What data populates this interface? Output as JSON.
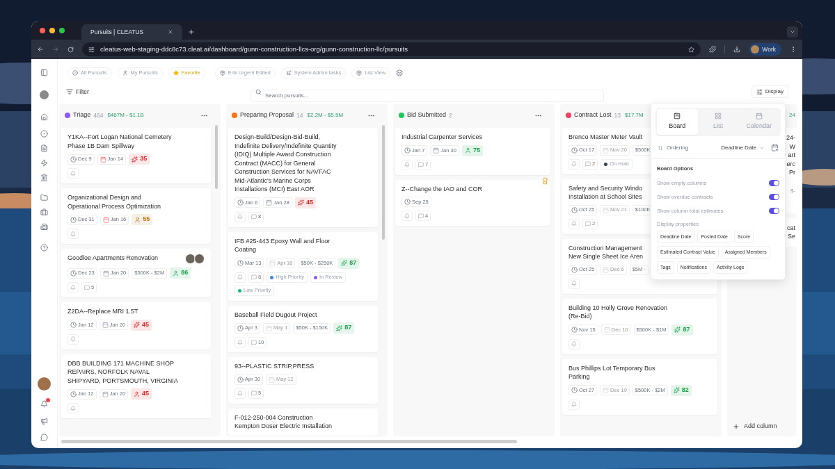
{
  "browser": {
    "tab_title": "Pursuits | CLEATUS",
    "url": "cleatus-web-staging-ddc8c73.cleat.ai/dashboard/gunn-construction-llcs-org/gunn-construction-llc/pursuits",
    "profile": "Work"
  },
  "rail": {
    "unread_notifications": true
  },
  "views": [
    {
      "label": "All Pursuits",
      "kind": "check",
      "selected": false
    },
    {
      "label": "My Pursuits",
      "kind": "person",
      "selected": false
    },
    {
      "label": "Favorite",
      "kind": "star",
      "selected": true
    },
    {
      "label": "Erik Urgent Edited",
      "kind": "stack",
      "selected": false
    },
    {
      "label": "System Admin tasks",
      "kind": "plane",
      "selected": false
    },
    {
      "label": "List View",
      "kind": "stack",
      "selected": false
    }
  ],
  "filter": {
    "label": "Filter"
  },
  "search": {
    "placeholder": "Search pursuits..."
  },
  "display_button": {
    "label": "Display"
  },
  "columns": [
    {
      "name": "Triage",
      "color": "#8b5cf6",
      "count": "464",
      "menu": true,
      "total": "$467M - $1.1B",
      "cards": [
        {
          "title": [
            "Y1KA--Fort Logan National Cemetery",
            "Phase 1B Dam Spillway"
          ],
          "chips": [
            {
              "kind": "deadline",
              "text": "Dec 9"
            },
            {
              "kind": "posted",
              "overdue": true,
              "faded": false,
              "text": "Jan 14"
            },
            {
              "kind": "score",
              "color": "#dc2626",
              "text": "35"
            }
          ],
          "bell": true
        },
        {
          "title": [
            "Organizational Design and",
            "Operational Process Optimization"
          ],
          "chips": [
            {
              "kind": "deadline",
              "text": "Dec 31"
            },
            {
              "kind": "posted",
              "overdue": true,
              "faded": false,
              "text": "Jan 16"
            },
            {
              "kind": "match",
              "color": "#b7791f",
              "text": "55"
            }
          ],
          "bell": true
        },
        {
          "title": [
            "Goodloe Apartments Renovation"
          ],
          "assignees": [
            {
              "kind": "picture"
            },
            {
              "kind": "picture"
            }
          ],
          "chips": [
            {
              "kind": "deadline",
              "text": "Dec 23"
            },
            {
              "kind": "posted",
              "overdue": false,
              "faded": false,
              "text": "Jan 20"
            },
            {
              "kind": "value",
              "text": "$500K - $2M"
            },
            {
              "kind": "match",
              "color": "#16a34a",
              "text": "86"
            }
          ],
          "bell": true,
          "comments": "5"
        },
        {
          "title": [
            "Z2DA--Replace MRI 1.5T"
          ],
          "chips": [
            {
              "kind": "deadline",
              "text": "Jan 12"
            },
            {
              "kind": "posted",
              "overdue": false,
              "faded": false,
              "text": "Jan 20"
            },
            {
              "kind": "score",
              "color": "#dc2626",
              "text": "45"
            }
          ],
          "bell": true
        },
        {
          "title": [
            "DBB BUILDING 171 MACHINE SHOP",
            "REPAIRS, NORFOLK NAVAL",
            "SHIPYARD, PORTSMOUTH, VIRGINIA"
          ],
          "chips": [
            {
              "kind": "deadline",
              "text": "Jan 12"
            },
            {
              "kind": "posted",
              "overdue": false,
              "faded": false,
              "text": "Jan 20"
            },
            {
              "kind": "match",
              "color": "#dc2626",
              "text": "45"
            }
          ],
          "bell": true
        }
      ]
    },
    {
      "name": "Preparing Proposal",
      "color": "#f97316",
      "count": "14",
      "menu": true,
      "total": "$2.2M - $5.5M",
      "cards": [
        {
          "title": [
            "Design-Build/Design-Bid-Build,",
            "Indefinite Delivery/Indefinite Quantity",
            "(IDIQ) Multiple Award Construction",
            "Contract (MACC) for General",
            "Construction Services for NAVFAC",
            "Mid-Atlantic's Marine Corps",
            "Installations (MCI) East AOR"
          ],
          "chips": [
            {
              "kind": "deadline",
              "text": "Jan 6"
            },
            {
              "kind": "posted",
              "overdue": false,
              "faded": false,
              "text": "Jan 28"
            },
            {
              "kind": "score",
              "color": "#dc2626",
              "text": "45"
            }
          ],
          "bell": true,
          "comments": "8"
        },
        {
          "title": [
            "IFB #25-443 Epoxy Wall and Floor",
            "Coating"
          ],
          "chips": [
            {
              "kind": "deadline",
              "text": "Mar 13"
            },
            {
              "kind": "posted",
              "overdue": false,
              "faded": true,
              "text": "Apr 16"
            },
            {
              "kind": "value",
              "text": "$50K - $250K"
            },
            {
              "kind": "score",
              "color": "#16a34a",
              "text": "87"
            }
          ],
          "bell": true,
          "comments": "8",
          "tags": [
            {
              "text": "High Priority",
              "color": "#3b82f6"
            },
            {
              "text": "In Review",
              "color": "#8b5cf6"
            },
            {
              "text": "Low Priority",
              "color": "#10b981"
            }
          ]
        },
        {
          "title": [
            "Baseball Field Dugout Project"
          ],
          "chips": [
            {
              "kind": "deadline",
              "text": "Apr 3"
            },
            {
              "kind": "posted",
              "overdue": false,
              "faded": true,
              "text": "May 1"
            },
            {
              "kind": "value",
              "text": "$50K - $150K"
            },
            {
              "kind": "score",
              "color": "#16a34a",
              "text": "87"
            }
          ],
          "bell": true,
          "comments": "10"
        },
        {
          "title": [
            "93--PLASTIC STRIP,PRESS"
          ],
          "chips": [
            {
              "kind": "deadline",
              "text": "Apr 30"
            },
            {
              "kind": "posted",
              "overdue": false,
              "faded": true,
              "text": "May 12"
            }
          ],
          "bell": true,
          "comments": "5"
        },
        {
          "title": [
            "F-012-250-004 Construction",
            "Kempton Doser Electric Installation"
          ],
          "bell": false
        }
      ]
    },
    {
      "name": "Bid Submitted",
      "color": "#22c55e",
      "count": "2",
      "menu": true,
      "cards": [
        {
          "title": [
            "Industrial Carpenter Services"
          ],
          "chips": [
            {
              "kind": "deadline",
              "text": "Jan 7"
            },
            {
              "kind": "posted",
              "overdue": false,
              "faded": false,
              "text": "Jan 30"
            },
            {
              "kind": "match",
              "color": "#16a34a",
              "text": "75"
            }
          ],
          "bell": true,
          "comments": "7"
        },
        {
          "title": [
            "Z--Change the IAO and COR"
          ],
          "award": true,
          "chips": [
            {
              "kind": "deadline",
              "text": "Sep 25"
            }
          ],
          "bell": true,
          "comments": "4"
        }
      ]
    },
    {
      "name": "Contract Lost",
      "color": "#f43f5e",
      "count": "13",
      "total": "$17.7M",
      "cards": [
        {
          "title": [
            "Brenco Master Meter Vault"
          ],
          "chips": [
            {
              "kind": "deadline",
              "text": "Oct 17"
            },
            {
              "kind": "posted",
              "overdue": false,
              "faded": true,
              "text": "Nov 20"
            },
            {
              "kind": "value",
              "text": "$500K"
            }
          ],
          "bell": true,
          "comments": "2",
          "tags": [
            {
              "text": "On Hold",
              "color": "#374151"
            }
          ]
        },
        {
          "title": [
            "Safety and Security Windo",
            "Installation at School Sites"
          ],
          "chips": [
            {
              "kind": "deadline",
              "text": "Oct 25"
            },
            {
              "kind": "posted",
              "overdue": false,
              "faded": true,
              "text": "Nov 21"
            },
            {
              "kind": "value",
              "text": "$100K"
            }
          ],
          "bell": true,
          "comments": "2"
        },
        {
          "title": [
            "Construction Management",
            "New Single Sheet Ice Aren"
          ],
          "chips": [
            {
              "kind": "deadline",
              "text": "Oct 25"
            },
            {
              "kind": "posted",
              "overdue": false,
              "faded": true,
              "text": "Dec 6"
            },
            {
              "kind": "value",
              "text": "$5M -"
            }
          ],
          "bell": true
        },
        {
          "title": [
            "Building 10 Holly Grove Renovation",
            "(Re-Bid)"
          ],
          "chips": [
            {
              "kind": "deadline",
              "text": "Nov 15"
            },
            {
              "kind": "posted",
              "overdue": false,
              "faded": true,
              "text": "Dec 10"
            },
            {
              "kind": "value",
              "text": "$500K - $1M"
            },
            {
              "kind": "score",
              "color": "#16a34a",
              "text": "87"
            }
          ],
          "bell": true
        },
        {
          "title": [
            "Bus Phillips Lot Temporary Bus",
            "Parking"
          ],
          "chips": [
            {
              "kind": "deadline",
              "text": "Oct 27"
            },
            {
              "kind": "posted",
              "overdue": false,
              "faded": true,
              "text": "Dec 19"
            },
            {
              "kind": "value",
              "text": "$500K - $2M"
            },
            {
              "kind": "score",
              "color": "#16a34a",
              "text": "82"
            }
          ],
          "bell": true
        }
      ]
    }
  ],
  "partial_column": {
    "total": "24",
    "cards": [
      {
        "lines": [
          "24-",
          "W",
          "art",
          "erc",
          "Pr"
        ],
        "meta": "$-"
      },
      {
        "lines": [
          "cat",
          "Se"
        ]
      }
    ],
    "add_label": "Add column"
  },
  "display_popover": {
    "tabs": [
      {
        "label": "Board",
        "kind": "board",
        "selected": true
      },
      {
        "label": "List",
        "kind": "list",
        "selected": false
      },
      {
        "label": "Calendar",
        "kind": "calendar",
        "selected": false
      }
    ],
    "ordering_label": "Ordering",
    "ordering_value": "Deadline Date",
    "options_heading": "Board Options",
    "toggles": [
      {
        "label": "Show empty columns",
        "on": true
      },
      {
        "label": "Show overdue contracts",
        "on": true
      },
      {
        "label": "Show column total estimates",
        "on": true
      }
    ],
    "properties_heading": "Display properties",
    "properties": [
      "Deadline Date",
      "Posted Date",
      "Score",
      "Estimated Contract Value",
      "Assigned Members",
      "Tags",
      "Notifications",
      "Activity Logs"
    ]
  }
}
